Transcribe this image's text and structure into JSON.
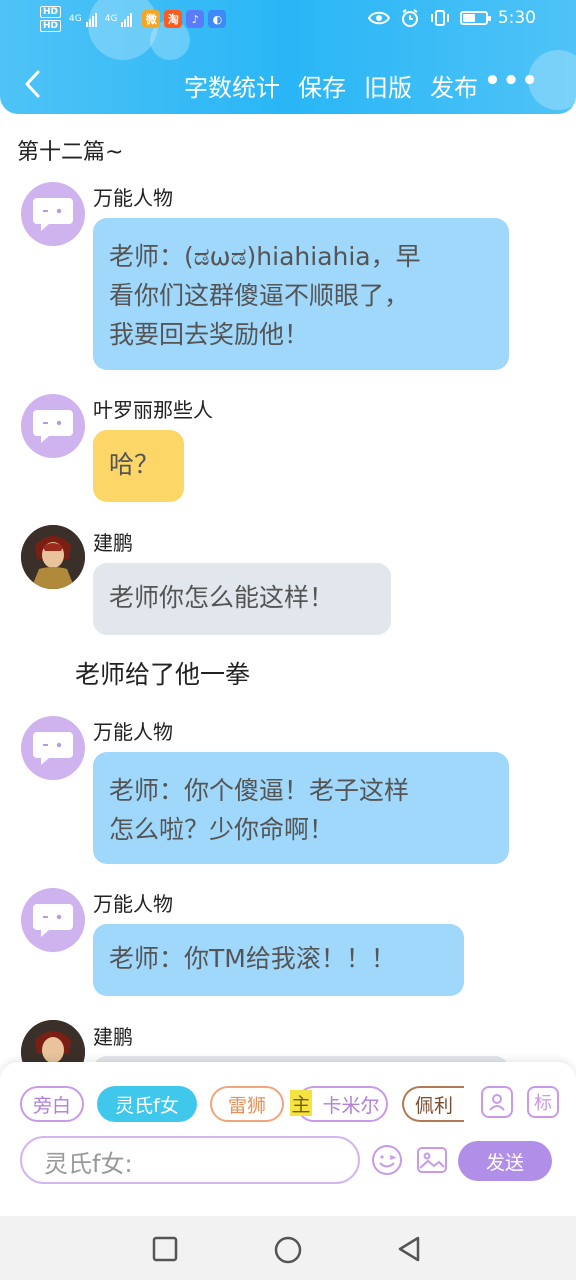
{
  "status_bar": {
    "hd1": "HD",
    "hd2": "HD",
    "net1": "4G",
    "net2": "4G",
    "app_icons": [
      "weibo-icon",
      "taobao-icon",
      "music-icon",
      "browser-icon"
    ],
    "right_icons": [
      "eye-icon",
      "alarm-icon",
      "vibrate-icon",
      "battery-icon"
    ],
    "time": "5:30"
  },
  "nav": {
    "back_icon": "chevron-left-icon",
    "actions": [
      "字数统计",
      "保存",
      "旧版",
      "发布"
    ],
    "more": "•••"
  },
  "story": {
    "title": "第十二篇~",
    "messages": [
      {
        "name": "万能人物",
        "avatar": "chat-bubble-avatar",
        "text": "老师：(ಡωಡ)hiahiahia，早看你们这群傻逼不顺眼了，我要回去奖励他！",
        "line1": "老师：(ಡωಡ)hiahiahia，早",
        "line2": "看你们这群傻逼不顺眼了，",
        "line3": "我要回去奖励他！"
      },
      {
        "name": "叶罗丽那些人",
        "avatar": "chat-bubble-avatar",
        "text": "哈？"
      },
      {
        "name": "建鹏",
        "avatar": "character-avatar",
        "text": "老师你怎么能这样！"
      },
      {
        "name": "万能人物",
        "avatar": "chat-bubble-avatar",
        "line1": "老师：你个傻逼！老子这样",
        "line2": "怎么啦？少你命啊！"
      },
      {
        "name": "万能人物",
        "avatar": "chat-bubble-avatar",
        "text": "老师：你TM给我滚！！！"
      },
      {
        "name": "建鹏",
        "avatar": "character-avatar",
        "text": ""
      }
    ],
    "narration": "老师给了他一拳"
  },
  "composer": {
    "roles": [
      "旁白",
      "灵氏f女",
      "雷狮",
      "卡米尔",
      "佩利"
    ],
    "selected_role": "灵氏f女",
    "main_mark": "主",
    "person_icon": "person-icon",
    "tag_label": "标",
    "input_placeholder": "灵氏f女:",
    "send_label": "发送"
  },
  "colors": {
    "header": "#29b6f6",
    "bubble_blue": "#9fd8fb",
    "bubble_yellow": "#fcd666",
    "bubble_gray": "#e2e7ed",
    "accent_purple": "#b18ee8",
    "selected_chip": "#3fc8ec"
  }
}
